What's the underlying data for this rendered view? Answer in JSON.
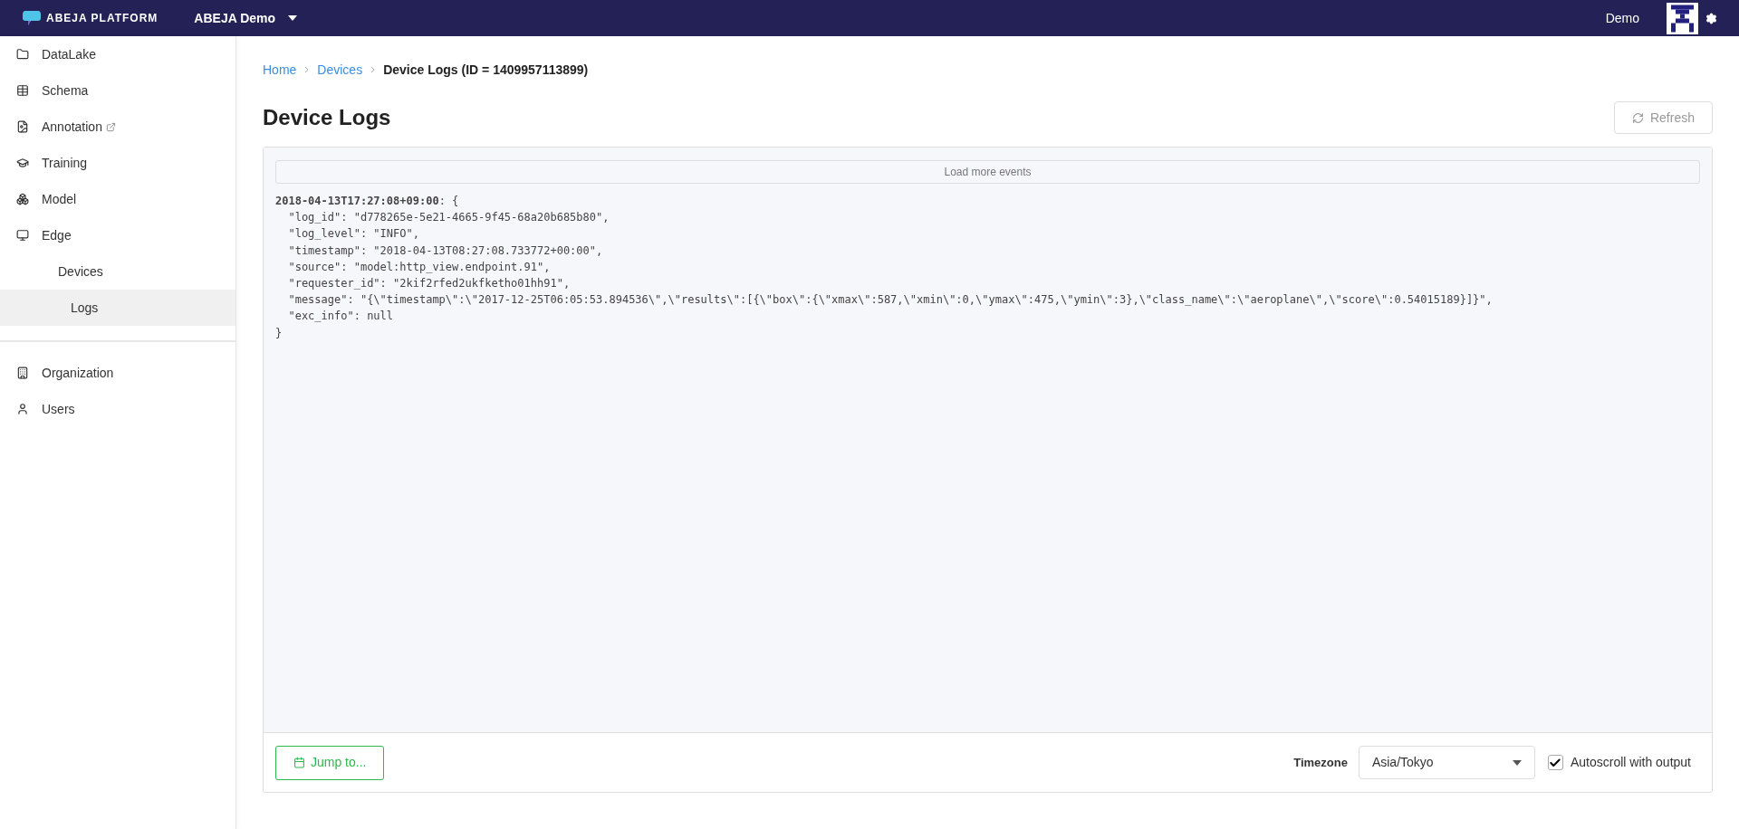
{
  "header": {
    "brand": "ABEJA PLATFORM",
    "org": "ABEJA Demo",
    "user": "Demo"
  },
  "sidebar": {
    "groups": [
      {
        "items": [
          {
            "label": "DataLake",
            "external": false,
            "selected": false
          },
          {
            "label": "Schema",
            "external": false,
            "selected": false
          },
          {
            "label": "Annotation",
            "external": true,
            "selected": false
          },
          {
            "label": "Training",
            "external": false,
            "selected": false
          },
          {
            "label": "Model",
            "external": false,
            "selected": false
          },
          {
            "label": "Edge",
            "external": false,
            "selected": false,
            "children": [
              {
                "label": "Devices",
                "selected": false,
                "children": [
                  {
                    "label": "Logs",
                    "selected": true
                  }
                ]
              }
            ]
          }
        ]
      },
      {
        "items": [
          {
            "label": "Organization",
            "external": false,
            "selected": false
          },
          {
            "label": "Users",
            "external": false,
            "selected": false
          }
        ]
      }
    ]
  },
  "breadcrumb": [
    {
      "label": "Home",
      "link": true
    },
    {
      "label": "Devices",
      "link": true
    },
    {
      "label": "Device Logs (ID = 1409957113899)",
      "link": false
    }
  ],
  "title": "Device Logs",
  "refresh_button": "Refresh",
  "log": {
    "load_more": "Load more events",
    "lines": [
      "**2018-04-13T17:27:08+09:00**: {",
      "  \"log_id\": \"d778265e-5e21-4665-9f45-68a20b685b80\",",
      "  \"log_level\": \"INFO\",",
      "  \"timestamp\": \"2018-04-13T08:27:08.733772+00:00\",",
      "  \"source\": \"model:http_view.endpoint.91\",",
      "  \"requester_id\": \"2kif2rfed2ukfketho01hh91\",",
      "  \"message\": \"{\\\"timestamp\\\":\\\"2017-12-25T06:05:53.894536\\\",\\\"results\\\":[{\\\"box\\\":{\\\"xmax\\\":587,\\\"xmin\\\":0,\\\"ymax\\\":475,\\\"ymin\\\":3},\\\"class_name\\\":\\\"aeroplane\\\",\\\"score\\\":0.54015189}]}\",",
      "  \"exc_info\": null",
      "}"
    ]
  },
  "footer": {
    "jump_button": "Jump to...",
    "timezone_label": "Timezone",
    "timezone_value": "Asia/Tokyo",
    "autoscroll": {
      "label": "Autoscroll with output",
      "checked": true
    }
  }
}
